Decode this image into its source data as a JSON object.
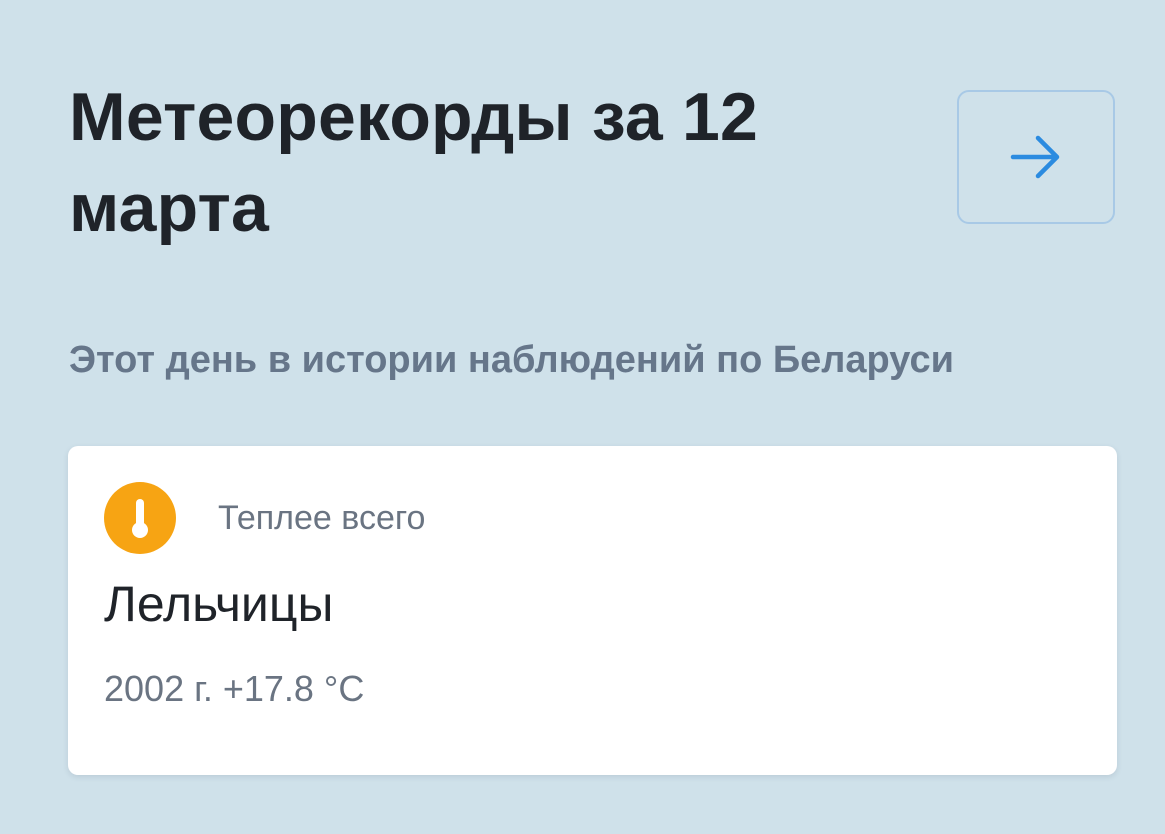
{
  "header": {
    "title": "Метеорекорды за 12 марта",
    "next_icon": "arrow-right-icon"
  },
  "subtitle": "Этот день в истории наблюдений по Беларуси",
  "record_card": {
    "icon": "thermometer-icon",
    "icon_color": "#f7a413",
    "label": "Теплее всего",
    "place": "Лельчицы",
    "value": "2002 г. +17.8 °C"
  },
  "colors": {
    "background": "#cfe1ea",
    "accent": "#2b8be0",
    "button_border": "#a8c9e6"
  }
}
